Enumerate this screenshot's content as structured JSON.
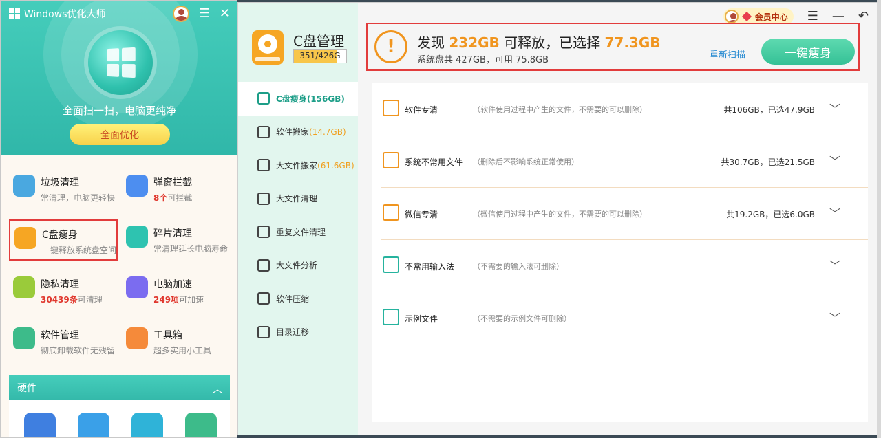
{
  "left_app": {
    "brand": "Windows优化大师",
    "slogan": "全面扫一扫，电脑更纯净",
    "optimize_button": "全面优化",
    "menu_icon": "list-icon",
    "close_icon": "close-icon",
    "tools": [
      {
        "name": "垃圾清理",
        "desc": "常清理，电脑更轻快",
        "count": "",
        "icon": "trash-icon",
        "color": "#4aa8e0"
      },
      {
        "name": "弹窗拦截",
        "desc": "可拦截",
        "count": "8个",
        "icon": "ad-block-icon",
        "color": "#4d8ef0"
      },
      {
        "name": "C盘瘦身",
        "desc": "一键释放系统盘空间",
        "count": "",
        "icon": "disk-slim-icon",
        "color": "#f6a623"
      },
      {
        "name": "碎片清理",
        "desc": "常清理延长电脑寿命",
        "count": "",
        "icon": "fragment-icon",
        "color": "#2ec3b0"
      },
      {
        "name": "隐私清理",
        "desc": "可清理",
        "count": "30439条",
        "icon": "privacy-icon",
        "color": "#9acb3a"
      },
      {
        "name": "电脑加速",
        "desc": "可加速",
        "count": "249项",
        "icon": "rocket-icon",
        "color": "#7b6cf0"
      },
      {
        "name": "软件管理",
        "desc": "彻底卸载软件无残留",
        "count": "",
        "icon": "box-icon",
        "color": "#3dbb8a"
      },
      {
        "name": "工具箱",
        "desc": "超多实用小工具",
        "count": "",
        "icon": "toolbox-icon",
        "color": "#f58a3a"
      }
    ],
    "hardware_label": "硬件",
    "hardware_icons": [
      {
        "icon": "monitor-icon",
        "color": "#3f7fe0"
      },
      {
        "icon": "disk-speed-icon",
        "color": "#3aa0e8"
      },
      {
        "icon": "thermometer-icon",
        "color": "#2fb3d8"
      },
      {
        "icon": "board-icon",
        "color": "#3dbb8a"
      }
    ]
  },
  "right_app": {
    "title": "C盘管理",
    "capacity": "351/426G",
    "capacity_fraction": 0.824,
    "nav": [
      {
        "label": "C盘瘦身",
        "size": "(156GB)",
        "icon": "slim-icon",
        "active": true
      },
      {
        "label": "软件搬家",
        "size": "(14.7GB)",
        "icon": "truck-icon",
        "active": false
      },
      {
        "label": "大文件搬家",
        "size": "(61.6GB)",
        "icon": "export-icon",
        "active": false
      },
      {
        "label": "大文件清理",
        "size": "",
        "icon": "broom-icon",
        "active": false
      },
      {
        "label": "重复文件清理",
        "size": "",
        "icon": "duplicate-icon",
        "active": false
      },
      {
        "label": "大文件分析",
        "size": "",
        "icon": "analysis-icon",
        "active": false
      },
      {
        "label": "软件压缩",
        "size": "",
        "icon": "compress-icon",
        "active": false
      },
      {
        "label": "目录迁移",
        "size": "",
        "icon": "migrate-icon",
        "active": false
      }
    ],
    "vip_label": "会员中心",
    "summary": {
      "prefix": "发现",
      "found": "232GB",
      "middle": "可释放，已选择",
      "selected": "77.3GB",
      "disk_info": "系统盘共 427GB，可用 75.8GB",
      "rescan": "重新扫描",
      "action": "一键瘦身"
    },
    "items": [
      {
        "name": "软件专清",
        "desc": "（软件使用过程中产生的文件，不需要的可以删除）",
        "stat": "共106GB，已选47.9GB",
        "icon": "grid-icon",
        "color": "#f0951f"
      },
      {
        "name": "系统不常用文件",
        "desc": "（删除后不影响系统正常使用）",
        "stat": "共30.7GB，已选21.5GB",
        "icon": "document-icon",
        "color": "#f0951f"
      },
      {
        "name": "微信专清",
        "desc": "（微信使用过程中产生的文件，不需要的可以删除）",
        "stat": "共19.2GB，已选6.0GB",
        "icon": "wechat-icon",
        "color": "#f0951f"
      },
      {
        "name": "不常用输入法",
        "desc": "（不需要的输入法可删除）",
        "stat": "",
        "icon": "input-method-icon",
        "color": "#26b39e"
      },
      {
        "name": "示例文件",
        "desc": "（不需要的示例文件可删除）",
        "stat": "",
        "icon": "code-file-icon",
        "color": "#26b39e"
      }
    ]
  }
}
